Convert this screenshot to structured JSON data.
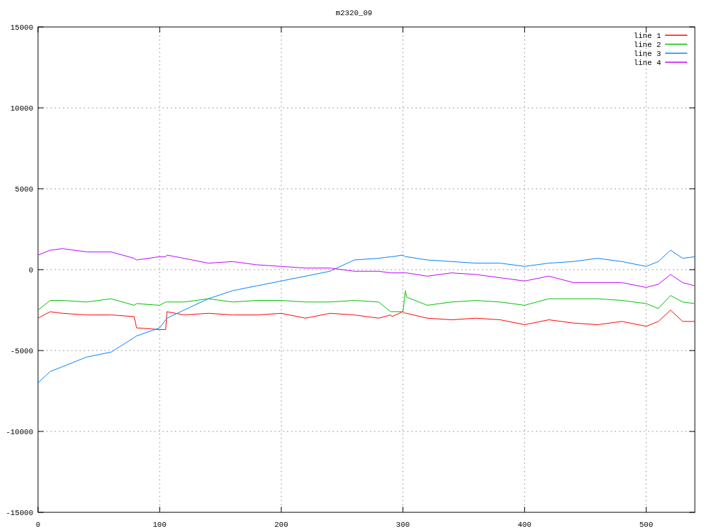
{
  "chart_data": {
    "type": "line",
    "title": "m2320_09",
    "grid": true,
    "legend": true,
    "xlim": [
      0,
      540
    ],
    "ylim": [
      -15000,
      15000
    ],
    "xticks": [
      0,
      100,
      200,
      300,
      400,
      500
    ],
    "yticks": [
      -15000,
      -10000,
      -5000,
      0,
      5000,
      10000,
      15000
    ],
    "x": [
      0,
      10,
      20,
      40,
      60,
      79,
      81,
      100,
      105,
      106,
      120,
      140,
      160,
      180,
      200,
      220,
      240,
      260,
      280,
      290,
      291,
      300,
      302,
      303,
      320,
      340,
      360,
      380,
      400,
      420,
      440,
      460,
      480,
      500,
      510,
      520,
      530,
      540
    ],
    "series": [
      {
        "name": "line 1",
        "color": "#ff0000",
        "values": [
          -3000,
          -2600,
          -2700,
          -2800,
          -2800,
          -2900,
          -3600,
          -3700,
          -3700,
          -2600,
          -2800,
          -2700,
          -2800,
          -2800,
          -2700,
          -3000,
          -2700,
          -2800,
          -3000,
          -2800,
          -2900,
          -2600,
          -2700,
          -2700,
          -3000,
          -3100,
          -3000,
          -3100,
          -3400,
          -3100,
          -3300,
          -3400,
          -3200,
          -3500,
          -3200,
          -2500,
          -3200,
          -3200
        ]
      },
      {
        "name": "line 2",
        "color": "#00c000",
        "values": [
          -2500,
          -1900,
          -1900,
          -2000,
          -1800,
          -2200,
          -2100,
          -2200,
          -2000,
          -2000,
          -2000,
          -1800,
          -2000,
          -1900,
          -1900,
          -2000,
          -2000,
          -1900,
          -2000,
          -2600,
          -2600,
          -2600,
          -1300,
          -1700,
          -2200,
          -2000,
          -1900,
          -2000,
          -2200,
          -1800,
          -1800,
          -1800,
          -1900,
          -2100,
          -2400,
          -1600,
          -2000,
          -2100
        ]
      },
      {
        "name": "line 3",
        "color": "#0080ff",
        "values": [
          -7000,
          -6300,
          -6000,
          -5400,
          -5100,
          -4200,
          -4100,
          -3600,
          -3100,
          -3000,
          -2500,
          -1800,
          -1300,
          -1000,
          -700,
          -400,
          -100,
          600,
          700,
          800,
          800,
          900,
          800,
          800,
          600,
          500,
          400,
          400,
          200,
          400,
          500,
          700,
          500,
          200,
          500,
          1200,
          700,
          800
        ]
      },
      {
        "name": "line 4",
        "color": "#c000ff",
        "values": [
          900,
          1200,
          1300,
          1100,
          1100,
          700,
          600,
          800,
          800,
          900,
          700,
          400,
          500,
          300,
          200,
          100,
          100,
          -100,
          -100,
          -200,
          -200,
          -200,
          -200,
          -200,
          -400,
          -200,
          -300,
          -500,
          -700,
          -400,
          -800,
          -800,
          -800,
          -1100,
          -900,
          -300,
          -800,
          -1000
        ]
      }
    ]
  }
}
